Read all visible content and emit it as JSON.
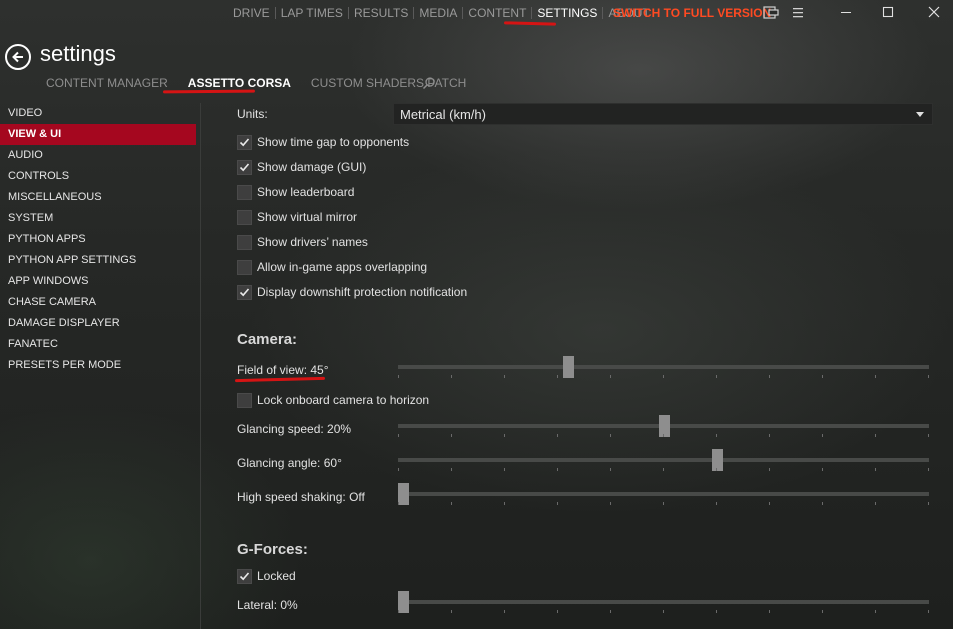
{
  "top_nav": {
    "items": [
      {
        "label": "DRIVE",
        "active": false
      },
      {
        "label": "LAP TIMES",
        "active": false
      },
      {
        "label": "RESULTS",
        "active": false
      },
      {
        "label": "MEDIA",
        "active": false
      },
      {
        "label": "CONTENT",
        "active": false
      },
      {
        "label": "SETTINGS",
        "active": true
      },
      {
        "label": "ABOUT",
        "active": false
      }
    ],
    "full_version": "SWITCH TO FULL VERSION",
    "accent_color": "#ff4a22"
  },
  "window_controls": {
    "icons": [
      "feedback-icon",
      "menu-icon",
      "minimize-icon",
      "maximize-icon",
      "close-icon"
    ]
  },
  "header": {
    "title": "settings",
    "tabs": [
      {
        "label": "CONTENT MANAGER",
        "active": false
      },
      {
        "label": "ASSETTO CORSA",
        "active": true
      },
      {
        "label": "CUSTOM SHADERS PATCH",
        "active": false
      }
    ]
  },
  "sidebar": {
    "active_color": "#a5071f",
    "items": [
      {
        "label": "VIDEO",
        "active": false
      },
      {
        "label": "VIEW & UI",
        "active": true
      },
      {
        "label": "AUDIO",
        "active": false
      },
      {
        "label": "CONTROLS",
        "active": false
      },
      {
        "label": "MISCELLANEOUS",
        "active": false
      },
      {
        "label": "SYSTEM",
        "active": false
      },
      {
        "label": "PYTHON APPS",
        "active": false
      },
      {
        "label": "PYTHON APP SETTINGS",
        "active": false
      },
      {
        "label": "APP WINDOWS",
        "active": false
      },
      {
        "label": "CHASE CAMERA",
        "active": false
      },
      {
        "label": "DAMAGE DISPLAYER",
        "active": false
      },
      {
        "label": "FANATEC",
        "active": false
      },
      {
        "label": "PRESETS PER MODE",
        "active": false
      }
    ]
  },
  "main": {
    "units": {
      "label": "Units:",
      "value": "Metrical (km/h)"
    },
    "ui_checkboxes": [
      {
        "label": "Show time gap to opponents",
        "checked": true
      },
      {
        "label": "Show damage (GUI)",
        "checked": true
      },
      {
        "label": "Show leaderboard",
        "checked": false
      },
      {
        "label": "Show virtual mirror",
        "checked": false
      },
      {
        "label": "Show drivers’ names",
        "checked": false
      },
      {
        "label": "Allow in-game apps overlapping",
        "checked": false
      },
      {
        "label": "Display downshift protection notification",
        "checked": true
      }
    ],
    "camera": {
      "title": "Camera:",
      "field_of_view": {
        "label": "Field of view: 45°",
        "value_fraction": 0.32
      },
      "lock_horizon": {
        "label": "Lock onboard camera to horizon",
        "checked": false
      },
      "glancing_speed": {
        "label": "Glancing speed: 20%",
        "value_fraction": 0.5
      },
      "glancing_angle": {
        "label": "Glancing angle: 60°",
        "value_fraction": 0.6
      },
      "high_speed_shaking": {
        "label": "High speed shaking: Off",
        "value_fraction": 0.0
      }
    },
    "gforces": {
      "title": "G-Forces:",
      "locked": {
        "label": "Locked",
        "checked": true
      },
      "lateral": {
        "label": "Lateral: 0%",
        "value_fraction": 0.0
      }
    }
  }
}
